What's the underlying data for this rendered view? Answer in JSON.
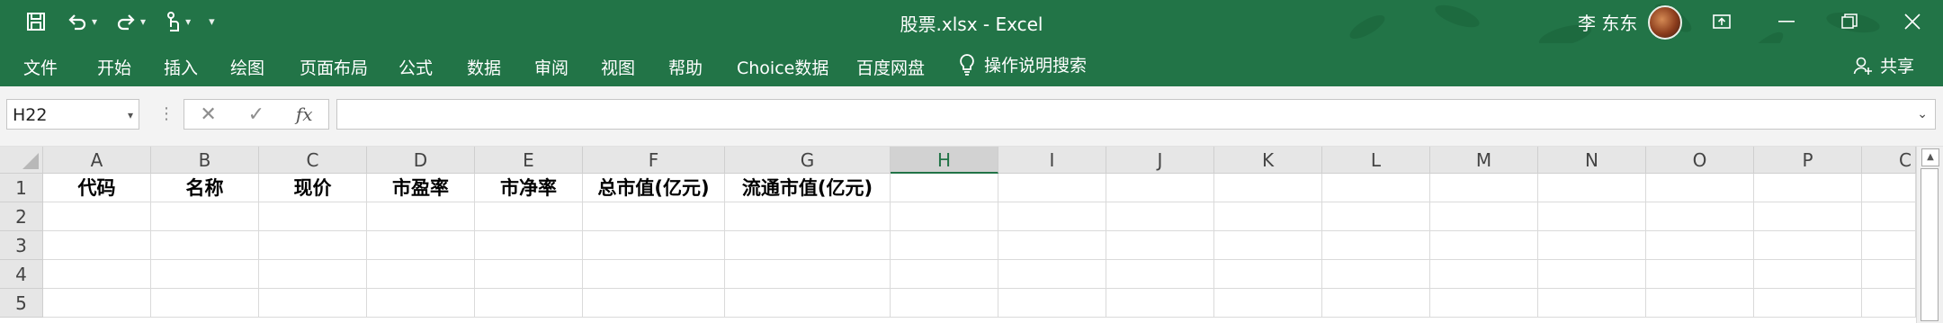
{
  "window": {
    "title": "股票.xlsx  -  Excel",
    "user": "李 东东",
    "buttons": {
      "ribbon_display": "ribbon-display-icon",
      "minimize": "minimize-icon",
      "restore": "restore-icon",
      "close": "close-icon"
    }
  },
  "qat": {
    "save": "save-icon",
    "undo": "undo-icon",
    "redo": "redo-icon",
    "touch": "touch-mode-icon",
    "customize": "customize-icon"
  },
  "menu": {
    "items": [
      "文件",
      "开始",
      "插入",
      "绘图",
      "页面布局",
      "公式",
      "数据",
      "审阅",
      "视图",
      "帮助",
      "Choice数据",
      "百度网盘"
    ],
    "tell_me": "操作说明搜索",
    "share": "共享"
  },
  "formula_bar": {
    "name_box": "H22",
    "fx": "fx",
    "value": ""
  },
  "sheet": {
    "columns": [
      "A",
      "B",
      "C",
      "D",
      "E",
      "F",
      "G",
      "H",
      "I",
      "J",
      "K",
      "L",
      "M",
      "N",
      "O",
      "P",
      "Q"
    ],
    "selected_column": "H",
    "rows": [
      "1",
      "2",
      "3",
      "4",
      "5"
    ],
    "row1": [
      "代码",
      "名称",
      "现价",
      "市盈率",
      "市净率",
      "总市值(亿元)",
      "流通市值(亿元)"
    ],
    "partial_last_col": "C"
  },
  "colors": {
    "ribbon": "#227447",
    "accent": "#217346"
  }
}
